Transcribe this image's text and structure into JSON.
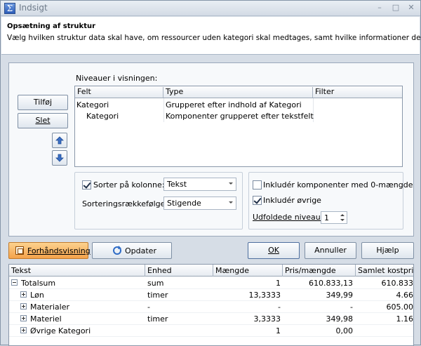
{
  "window": {
    "title": "Indsigt",
    "minimize": "–",
    "maximize": "□",
    "close": "✕"
  },
  "header": {
    "title": "Opsætning af struktur",
    "description": "Vælg hvilken struktur data skal have, om ressourcer uden kategori skal medtages, samt hvilke informationer der skal"
  },
  "left_buttons": {
    "add": "Tilføj",
    "delete": "Slet"
  },
  "levels": {
    "label": "Niveauer i visningen:",
    "columns": [
      "Felt",
      "Type",
      "Filter"
    ],
    "rows": [
      {
        "felt": "Kategori",
        "type": "Grupperet efter indhold af Kategori",
        "filter": ""
      },
      {
        "felt": "Kategori",
        "type": "Komponenter grupperet efter tekstfelt",
        "filter": ""
      }
    ]
  },
  "sort": {
    "sort_on_column_label": "Sorter på kolonne:",
    "sort_on_column_checked": true,
    "sort_column_value": "Tekst",
    "sort_order_label": "Sorteringsrækkefølge:",
    "sort_order_value": "Stigende"
  },
  "include": {
    "zero_qty_label": "Inkludér komponenter med 0-mængde",
    "zero_qty_checked": false,
    "other_label": "Inkludér øvrige",
    "other_checked": true,
    "unfold_label": "Udfoldede niveauer",
    "unfold_value": "1"
  },
  "actions": {
    "preview": "Forhåndsvisning",
    "update": "Opdater",
    "ok": "OK",
    "cancel": "Annuller",
    "help": "Hjælp"
  },
  "results": {
    "columns": [
      "Tekst",
      "Enhed",
      "Mængde",
      "Pris/mængde",
      "Samlet kostpris"
    ],
    "rows": [
      {
        "tekst": "Totalsum",
        "enhed": "sum",
        "maengde": "1",
        "pris": "610.833,13",
        "samlet": "610.833",
        "expander": "minus",
        "indent": 0
      },
      {
        "tekst": "Løn",
        "enhed": "timer",
        "maengde": "13,3333",
        "pris": "349,99",
        "samlet": "4.66",
        "expander": "plus",
        "indent": 1
      },
      {
        "tekst": "Materialer",
        "enhed": "-",
        "maengde": "-",
        "pris": "-",
        "samlet": "605.00",
        "expander": "plus",
        "indent": 1
      },
      {
        "tekst": "Materiel",
        "enhed": "timer",
        "maengde": "3,3333",
        "pris": "349,98",
        "samlet": "1.16",
        "expander": "plus",
        "indent": 1
      },
      {
        "tekst": "Øvrige Kategori",
        "enhed": "",
        "maengde": "1",
        "pris": "0,00",
        "samlet": "",
        "expander": "plus",
        "indent": 1
      }
    ]
  },
  "colors": {
    "preview_accent": "#f4a24a",
    "window_bg": "#d6dde6"
  }
}
